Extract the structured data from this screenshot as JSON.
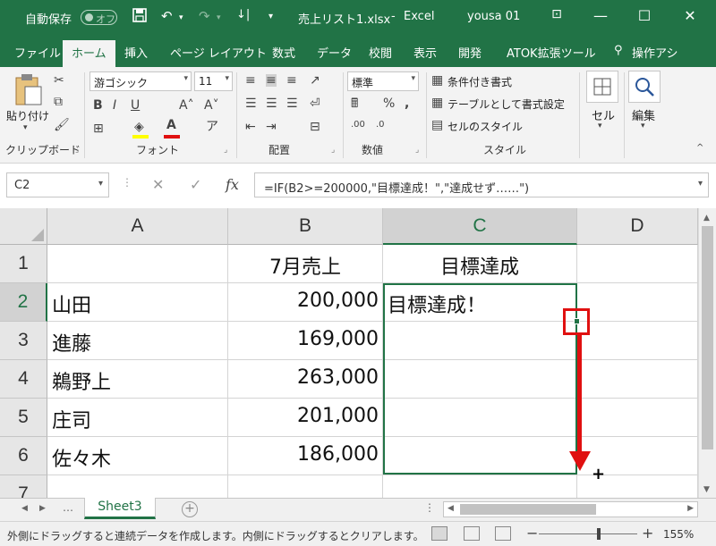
{
  "titlebar": {
    "autosave_label": "自動保存",
    "autosave_state": "オフ",
    "document_title": "売上リスト1.xlsx",
    "separator": "-",
    "app_name": "Excel",
    "user": "yousa 01"
  },
  "tabs": [
    "ファイル",
    "ホーム",
    "挿入",
    "ページ レイアウト",
    "数式",
    "データ",
    "校閲",
    "表示",
    "開発",
    "ATOK拡張ツール",
    "操作アシ"
  ],
  "active_tab": "ホーム",
  "ribbon": {
    "clipboard": {
      "paste_label": "貼り付け",
      "group": "クリップボード"
    },
    "font": {
      "font_name": "游ゴシック",
      "font_size": "11",
      "group": "フォント"
    },
    "alignment": {
      "group": "配置"
    },
    "number": {
      "format": "標準",
      "group": "数値"
    },
    "styles": {
      "conditional": "条件付き書式",
      "table": "テーブルとして書式設定",
      "cell_styles": "セルのスタイル",
      "group": "スタイル"
    },
    "cells": {
      "label": "セル"
    },
    "editing": {
      "label": "編集"
    }
  },
  "formula_bar": {
    "name_box": "C2",
    "formula": "=IF(B2>=200000,\"目標達成！\",\"達成せず……\")"
  },
  "sheet": {
    "columns": [
      "A",
      "B",
      "C",
      "D"
    ],
    "selected_column": "C",
    "rows": [
      "1",
      "2",
      "3",
      "4",
      "5",
      "6",
      "7"
    ],
    "header_row": {
      "b": "7月売上",
      "c": "目標達成"
    },
    "data": [
      {
        "name": "山田",
        "sales": "200,000",
        "result": "目標達成！"
      },
      {
        "name": "進藤",
        "sales": "169,000",
        "result": ""
      },
      {
        "name": "鵜野上",
        "sales": "263,000",
        "result": ""
      },
      {
        "name": "庄司",
        "sales": "201,000",
        "result": ""
      },
      {
        "name": "佐々木",
        "sales": "186,000",
        "result": ""
      }
    ],
    "sheet_tab": "Sheet3"
  },
  "statusbar": {
    "message": "外側にドラッグすると連続データを作成します。内側にドラッグするとクリアします。",
    "zoom": "155%"
  },
  "colors": {
    "brand": "#217346",
    "annotation": "#e01010"
  }
}
